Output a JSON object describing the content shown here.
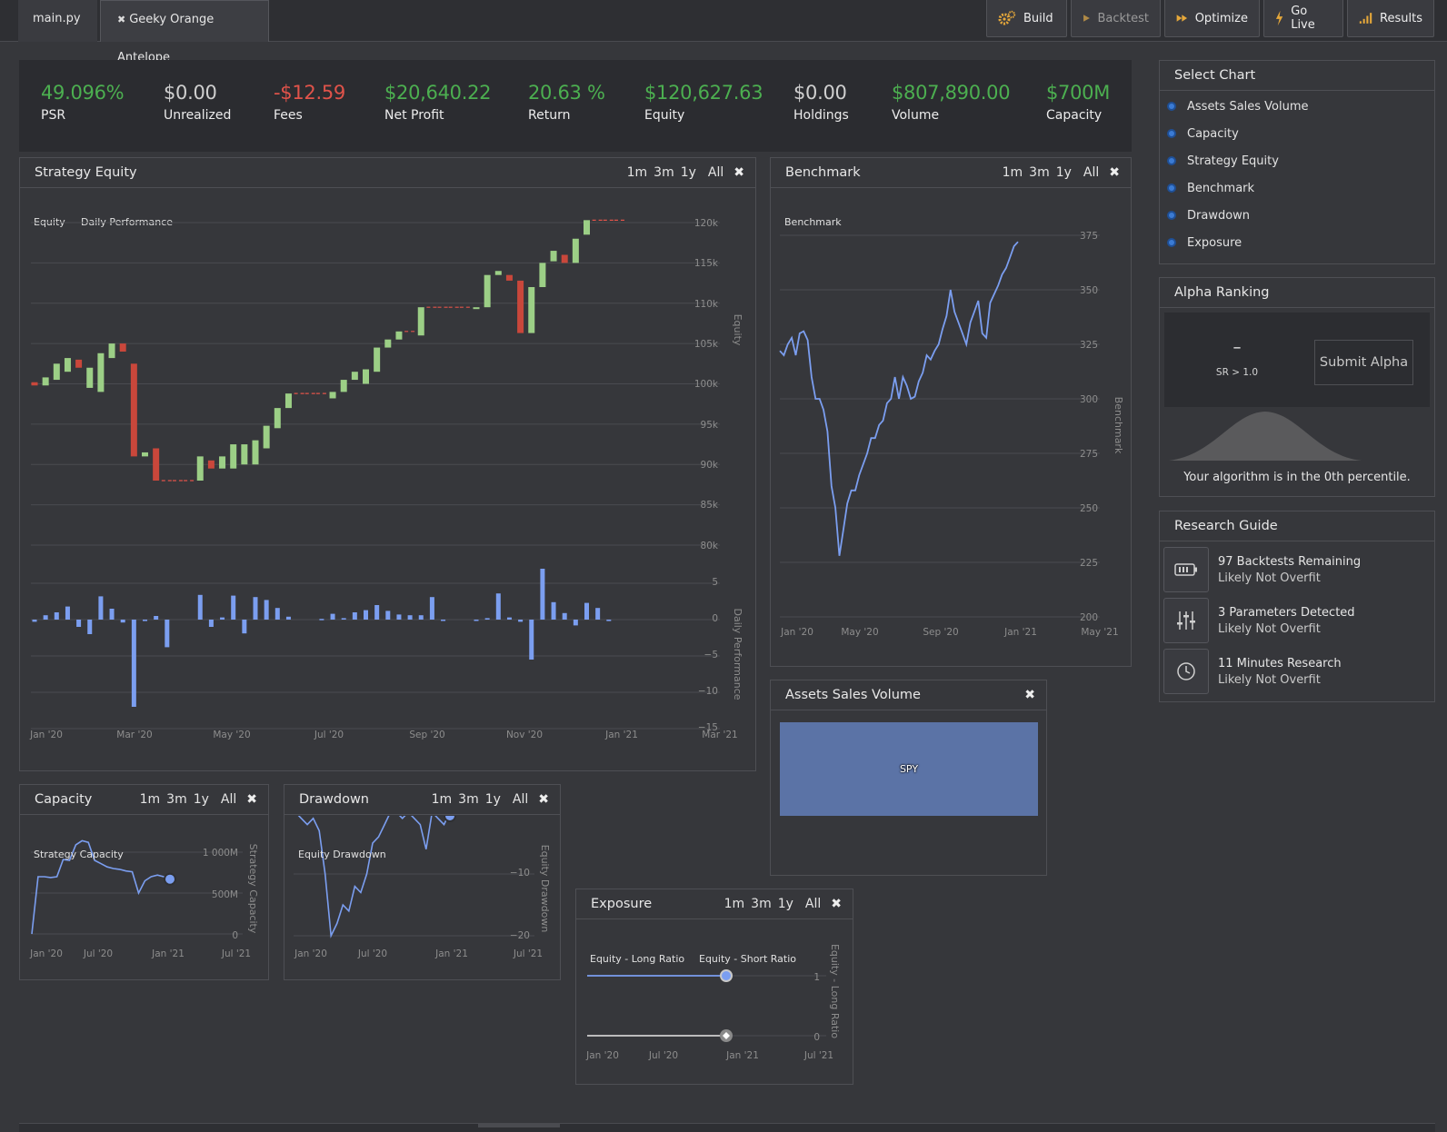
{
  "tabs": [
    {
      "label": "main.py"
    },
    {
      "label": "Geeky Orange Antelope"
    }
  ],
  "toolbar": {
    "build": "Build",
    "backtest": "Backtest",
    "optimize": "Optimize",
    "go_live": "Go Live",
    "results": "Results"
  },
  "stats": [
    {
      "value": "49.096%",
      "label": "PSR",
      "color": "#4caf50"
    },
    {
      "value": "$0.00",
      "label": "Unrealized",
      "color": "#cfcfcf"
    },
    {
      "value": "-$12.59",
      "label": "Fees",
      "color": "#e0534a"
    },
    {
      "value": "$20,640.22",
      "label": "Net Profit",
      "color": "#4caf50"
    },
    {
      "value": "20.63 %",
      "label": "Return",
      "color": "#4caf50"
    },
    {
      "value": "$120,627.63",
      "label": "Equity",
      "color": "#4caf50"
    },
    {
      "value": "$0.00",
      "label": "Holdings",
      "color": "#cfcfcf"
    },
    {
      "value": "$807,890.00",
      "label": "Volume",
      "color": "#4caf50"
    },
    {
      "value": "$700M",
      "label": "Capacity",
      "color": "#4caf50"
    }
  ],
  "range_buttons": [
    "1m",
    "3m",
    "1y",
    "All"
  ],
  "strategy_equity": {
    "title": "Strategy Equity",
    "legend": [
      "Equity",
      "Daily Performance"
    ],
    "y_axis_label": "Equity",
    "y2_axis_label": "Daily Performance",
    "y_ticks": [
      "120k",
      "115k",
      "110k",
      "105k",
      "100k",
      "95k",
      "90k",
      "85k",
      "80k"
    ],
    "y2_ticks": [
      "5",
      "0",
      "−5",
      "−10",
      "−15"
    ],
    "x_ticks": [
      "Jan '20",
      "Mar '20",
      "May '20",
      "Jul '20",
      "Sep '20",
      "Nov '20",
      "Jan '21",
      "Mar '21"
    ]
  },
  "benchmark": {
    "title": "Benchmark",
    "legend": "Benchmark",
    "y_axis_label": "Benchmark",
    "y_ticks": [
      "375",
      "350",
      "325",
      "300",
      "275",
      "250",
      "225",
      "200"
    ],
    "x_ticks": [
      "Jan '20",
      "May '20",
      "Sep '20",
      "Jan '21",
      "May '21"
    ]
  },
  "assets_sales_volume": {
    "title": "Assets Sales Volume",
    "block_label": "SPY"
  },
  "capacity": {
    "title": "Capacity",
    "legend": "Strategy Capacity",
    "y_axis_label": "Strategy Capacity",
    "y_ticks": [
      "1 000M",
      "500M",
      "0"
    ],
    "x_ticks": [
      "Jan '20",
      "Jul '20",
      "Jan '21",
      "Jul '21"
    ]
  },
  "drawdown": {
    "title": "Drawdown",
    "legend": "Equity Drawdown",
    "y_axis_label": "Equity Drawdown",
    "y_ticks": [
      "−10",
      "−20"
    ],
    "x_ticks": [
      "Jan '20",
      "Jul '20",
      "Jan '21",
      "Jul '21"
    ]
  },
  "exposure": {
    "title": "Exposure",
    "legend": [
      "Equity - Long Ratio",
      "Equity - Short Ratio"
    ],
    "y_axis_label": "Equity - Long Ratio",
    "y_ticks": [
      "1",
      "0"
    ],
    "x_ticks": [
      "Jan '20",
      "Jul '20",
      "Jan '21",
      "Jul '21"
    ]
  },
  "select_chart": {
    "title": "Select Chart",
    "items": [
      "Assets Sales Volume",
      "Capacity",
      "Strategy Equity",
      "Benchmark",
      "Drawdown",
      "Exposure"
    ]
  },
  "alpha_ranking": {
    "title": "Alpha Ranking",
    "score": "–",
    "score_sub": "SR > 1.0",
    "submit": "Submit Alpha",
    "percentile_text": "Your algorithm is in the 0th percentile."
  },
  "research_guide": {
    "title": "Research Guide",
    "items": [
      {
        "main": "97 Backtests Remaining",
        "sub": "Likely Not Overfit",
        "icon": "battery-icon"
      },
      {
        "main": "3 Parameters Detected",
        "sub": "Likely Not Overfit",
        "icon": "sliders-icon"
      },
      {
        "main": "11 Minutes Research",
        "sub": "Likely Not Overfit",
        "icon": "clock-icon"
      }
    ]
  },
  "chart_data": [
    {
      "type": "candlestick",
      "title": "Strategy Equity",
      "ylabel": "Equity",
      "ylim": [
        80000,
        122000
      ],
      "x_ticks": [
        "Jan '20",
        "Mar '20",
        "May '20",
        "Jul '20",
        "Sep '20",
        "Nov '20",
        "Jan '21",
        "Mar '21"
      ],
      "candles": [
        {
          "o": 100200,
          "c": 99800
        },
        {
          "o": 99800,
          "c": 100800
        },
        {
          "o": 100500,
          "c": 102500
        },
        {
          "o": 101500,
          "c": 103200
        },
        {
          "o": 103000,
          "c": 102000
        },
        {
          "o": 99500,
          "c": 102000
        },
        {
          "o": 99000,
          "c": 103800
        },
        {
          "o": 103200,
          "c": 105000
        },
        {
          "o": 105000,
          "c": 104000
        },
        {
          "o": 102500,
          "c": 91000
        },
        {
          "o": 91000,
          "c": 91500
        },
        {
          "o": 92000,
          "c": 88000
        },
        {
          "o": 88000,
          "c": 88000
        },
        {
          "o": 88000,
          "c": 88000
        },
        {
          "o": 88000,
          "c": 88000
        },
        {
          "o": 88000,
          "c": 91000
        },
        {
          "o": 90500,
          "c": 89500
        },
        {
          "o": 89500,
          "c": 91000
        },
        {
          "o": 89500,
          "c": 92500
        },
        {
          "o": 90000,
          "c": 92500
        },
        {
          "o": 90000,
          "c": 93000
        },
        {
          "o": 92000,
          "c": 94800
        },
        {
          "o": 94500,
          "c": 97000
        },
        {
          "o": 97000,
          "c": 98800
        },
        {
          "o": 98800,
          "c": 98800
        },
        {
          "o": 98800,
          "c": 98800
        },
        {
          "o": 98800,
          "c": 98800
        },
        {
          "o": 98200,
          "c": 99000
        },
        {
          "o": 99000,
          "c": 100500
        },
        {
          "o": 100500,
          "c": 101500
        },
        {
          "o": 100000,
          "c": 101800
        },
        {
          "o": 101500,
          "c": 104500
        },
        {
          "o": 104500,
          "c": 105500
        },
        {
          "o": 105500,
          "c": 106500
        },
        {
          "o": 106500,
          "c": 106500
        },
        {
          "o": 106000,
          "c": 109500
        },
        {
          "o": 109500,
          "c": 109500
        },
        {
          "o": 109500,
          "c": 109500
        },
        {
          "o": 109500,
          "c": 109500
        },
        {
          "o": 109500,
          "c": 109500
        },
        {
          "o": 109300,
          "c": 109500
        },
        {
          "o": 109500,
          "c": 113500
        },
        {
          "o": 113500,
          "c": 114000
        },
        {
          "o": 113500,
          "c": 112800
        },
        {
          "o": 112800,
          "c": 106300
        },
        {
          "o": 106300,
          "c": 112000
        },
        {
          "o": 112000,
          "c": 115000
        },
        {
          "o": 115200,
          "c": 116500
        },
        {
          "o": 116000,
          "c": 115000
        },
        {
          "o": 115000,
          "c": 118000
        },
        {
          "o": 118500,
          "c": 120300
        },
        {
          "o": 120300,
          "c": 120300
        },
        {
          "o": 120300,
          "c": 120300
        },
        {
          "o": 120300,
          "c": 120300
        }
      ]
    },
    {
      "type": "bar",
      "title": "Daily Performance",
      "ylabel": "Daily Performance",
      "ylim": [
        -15,
        6
      ],
      "values": [
        -0.3,
        0.6,
        1.0,
        1.8,
        -1.0,
        -2.0,
        3.2,
        1.5,
        -0.4,
        -12.0,
        -0.2,
        0.5,
        -3.8,
        0,
        0,
        3.4,
        -1.0,
        0.3,
        3.3,
        -1.9,
        3.1,
        2.7,
        1.6,
        0.4,
        0,
        0,
        0.1,
        0.8,
        0.2,
        1.0,
        1.3,
        2.0,
        1.2,
        0.7,
        0.6,
        0.6,
        3.1,
        -0.1,
        0,
        0,
        -0.1,
        0.2,
        3.6,
        0.3,
        -0.3,
        -5.5,
        7.0,
        2.4,
        0.9,
        -0.8,
        2.3,
        1.6,
        -0.2
      ]
    },
    {
      "type": "line",
      "title": "Benchmark",
      "ylabel": "Benchmark",
      "ylim": [
        200,
        375
      ],
      "x_ticks": [
        "Jan '20",
        "May '20",
        "Sep '20",
        "Jan '21",
        "May '21"
      ],
      "values": [
        322,
        320,
        325,
        328,
        320,
        330,
        331,
        327,
        310,
        300,
        300,
        295,
        285,
        260,
        250,
        228,
        240,
        252,
        258,
        258,
        265,
        270,
        275,
        282,
        282,
        288,
        290,
        298,
        300,
        310,
        300,
        310,
        306,
        300,
        301,
        308,
        312,
        320,
        318,
        322,
        325,
        332,
        338,
        350,
        340,
        335,
        330,
        325,
        335,
        340,
        345,
        330,
        328,
        344,
        348,
        352,
        357,
        360,
        365,
        370,
        372
      ]
    },
    {
      "type": "line",
      "title": "Capacity",
      "ylabel": "Strategy Capacity",
      "ylim": [
        0,
        1200
      ],
      "values": [
        0,
        700,
        700,
        690,
        700,
        910,
        900,
        1090,
        1140,
        1120,
        900,
        860,
        820,
        800,
        790,
        770,
        760,
        500,
        650,
        700,
        720,
        700,
        670
      ]
    },
    {
      "type": "line",
      "title": "Drawdown",
      "ylabel": "Equity Drawdown",
      "ylim": [
        -22,
        0
      ],
      "values": [
        0,
        -1,
        -2,
        -1,
        -3,
        -10,
        -20,
        -18,
        -15,
        -16,
        -12,
        -13,
        -10,
        -5,
        -4,
        -2,
        0,
        0,
        -1,
        0,
        -1,
        -2,
        -6,
        0,
        -1,
        -2,
        0
      ]
    },
    {
      "type": "line",
      "title": "Exposure",
      "ylabel": "Equity - Long Ratio",
      "ylim": [
        0,
        1
      ],
      "series": [
        {
          "name": "Equity - Long Ratio",
          "values": [
            1,
            1,
            1,
            1,
            1,
            1
          ]
        },
        {
          "name": "Equity - Short Ratio",
          "values": [
            0,
            0,
            0,
            0,
            0,
            0
          ]
        }
      ]
    }
  ]
}
